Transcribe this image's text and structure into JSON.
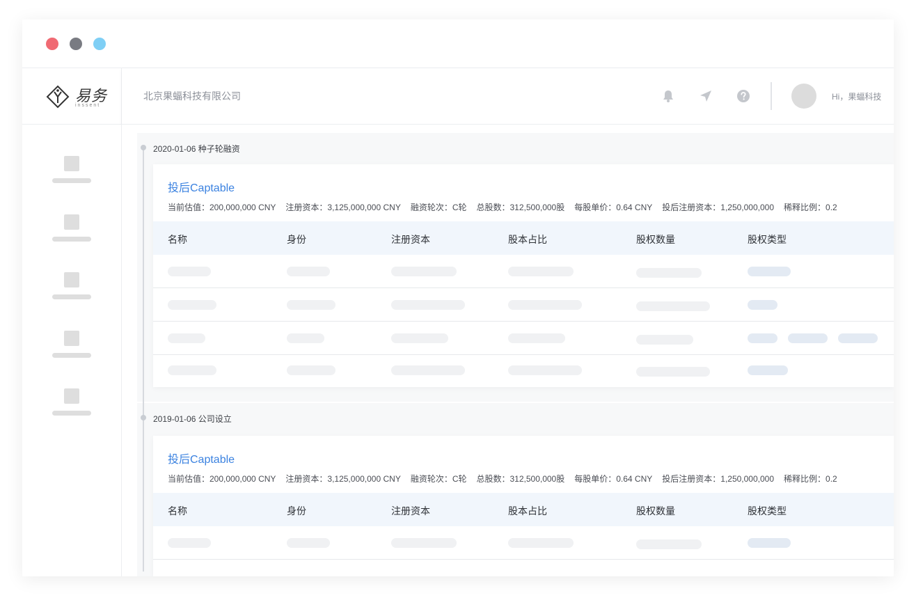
{
  "window": {
    "controls": [
      "close",
      "minimize",
      "zoom"
    ],
    "colors": {
      "close": "#f06a73",
      "minimize": "#797b82",
      "zoom": "#7fcff5"
    }
  },
  "logo": {
    "text": "易务",
    "subtext": "inssent"
  },
  "header": {
    "company": "北京果蝠科技有限公司",
    "icons": [
      "bell-icon",
      "send-icon",
      "help-icon"
    ],
    "greeting": "Hi，果蝠科技"
  },
  "sidebar": {
    "item_count": 5
  },
  "timeline": [
    {
      "label": "2020-01-06 种子轮融资",
      "card": {
        "title": "投后Captable",
        "meta": [
          "当前估值：200,000,000 CNY",
          "注册资本：3,125,000,000 CNY",
          "融资轮次：C轮",
          "总股数：312,500,000股",
          "每股单价：0.64 CNY",
          "投后注册资本：1,250,000,000",
          "稀释比例：0.2"
        ],
        "columns": [
          "名称",
          "身份",
          "注册资本",
          "股本占比",
          "股权数量",
          "股权类型"
        ]
      }
    },
    {
      "label": "2019-01-06 公司设立",
      "card": {
        "title": "投后Captable",
        "meta": [
          "当前估值：200,000,000 CNY",
          "注册资本：3,125,000,000 CNY",
          "融资轮次：C轮",
          "总股数：312,500,000股",
          "每股单价：0.64 CNY",
          "投后注册资本：1,250,000,000",
          "稀释比例：0.2"
        ],
        "columns": [
          "名称",
          "身份",
          "注册资本",
          "股本占比",
          "股权数量",
          "股权类型"
        ]
      }
    }
  ],
  "colors": {
    "accent": "#3b82e0",
    "header_row": "#f1f6fc",
    "skeleton": "#f0f1f3",
    "skeleton_tag": "#e3eaf3"
  }
}
